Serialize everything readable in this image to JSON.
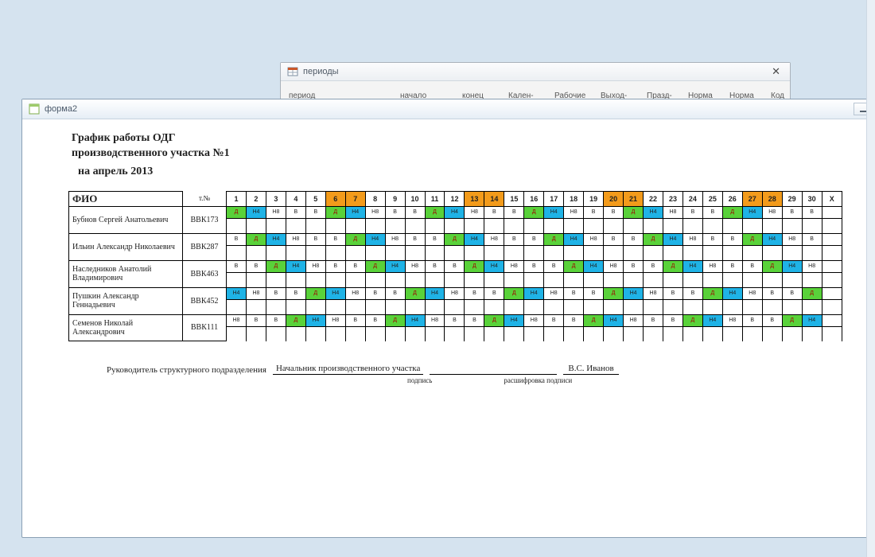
{
  "periodsWindow": {
    "title": "периоды",
    "columns": [
      "период",
      "начало",
      "конец",
      "Кален-",
      "Рабочие",
      "Выход-",
      "Празд-",
      "Норма",
      "Норма",
      "Код"
    ]
  },
  "formWindow": {
    "title": "форма2"
  },
  "report": {
    "titleLines": [
      "График работы ОДГ",
      "производственного участка №1",
      "на апрель 2013"
    ],
    "fioHeader": "ФИО",
    "tnoHeader": "т.№",
    "days": [
      "1",
      "2",
      "3",
      "4",
      "5",
      "6",
      "7",
      "8",
      "9",
      "10",
      "11",
      "12",
      "13",
      "14",
      "15",
      "16",
      "17",
      "18",
      "19",
      "20",
      "21",
      "22",
      "23",
      "24",
      "25",
      "26",
      "27",
      "28",
      "29",
      "30",
      "X"
    ],
    "weekendDays": [
      6,
      7,
      13,
      14,
      20,
      21,
      27,
      28
    ],
    "rows": [
      {
        "name": "Бубнов Сергей Анатольевич",
        "tno": "ВВК173",
        "cells": [
          "Д",
          "Н4",
          "Н8",
          "В",
          "В",
          "Д",
          "Н4",
          "Н8",
          "В",
          "В",
          "Д",
          "Н4",
          "Н8",
          "В",
          "В",
          "Д",
          "Н4",
          "Н8",
          "В",
          "В",
          "Д",
          "Н4",
          "Н8",
          "В",
          "В",
          "Д",
          "Н4",
          "Н8",
          "В",
          "В",
          ""
        ]
      },
      {
        "name": "Ильин Александр Николаевич",
        "tno": "ВВК287",
        "cells": [
          "В",
          "Д",
          "Н4",
          "Н8",
          "В",
          "В",
          "Д",
          "Н4",
          "Н8",
          "В",
          "В",
          "Д",
          "Н4",
          "Н8",
          "В",
          "В",
          "Д",
          "Н4",
          "Н8",
          "В",
          "В",
          "Д",
          "Н4",
          "Н8",
          "В",
          "В",
          "Д",
          "Н4",
          "Н8",
          "В",
          ""
        ]
      },
      {
        "name": "Наследников Анатолий Владимирович",
        "tno": "ВВК463",
        "cells": [
          "В",
          "В",
          "Д",
          "Н4",
          "Н8",
          "В",
          "В",
          "Д",
          "Н4",
          "Н8",
          "В",
          "В",
          "Д",
          "Н4",
          "Н8",
          "В",
          "В",
          "Д",
          "Н4",
          "Н8",
          "В",
          "В",
          "Д",
          "Н4",
          "Н8",
          "В",
          "В",
          "Д",
          "Н4",
          "Н8",
          ""
        ]
      },
      {
        "name": "Пушкин Александр Геннадьевич",
        "tno": "ВВК452",
        "cells": [
          "Н4",
          "Н8",
          "В",
          "В",
          "Д",
          "Н4",
          "Н8",
          "В",
          "В",
          "Д",
          "Н4",
          "Н8",
          "В",
          "В",
          "Д",
          "Н4",
          "Н8",
          "В",
          "В",
          "Д",
          "Н4",
          "Н8",
          "В",
          "В",
          "Д",
          "Н4",
          "Н8",
          "В",
          "В",
          "Д",
          ""
        ]
      },
      {
        "name": "Семенов Николай Александрович",
        "tno": "ВВК111",
        "cells": [
          "Н8",
          "В",
          "В",
          "Д",
          "Н4",
          "Н8",
          "В",
          "В",
          "Д",
          "Н4",
          "Н8",
          "В",
          "В",
          "Д",
          "Н4",
          "Н8",
          "В",
          "В",
          "Д",
          "Н4",
          "Н8",
          "В",
          "В",
          "Д",
          "Н4",
          "Н8",
          "В",
          "В",
          "Д",
          "Н4",
          ""
        ]
      }
    ],
    "signature": {
      "label": "Руководитель структурного подразделения",
      "role": "Начальник производственного участка",
      "person": "В.С. Иванов",
      "sub1": "подпись",
      "sub2": "расшифровка подписи"
    }
  }
}
